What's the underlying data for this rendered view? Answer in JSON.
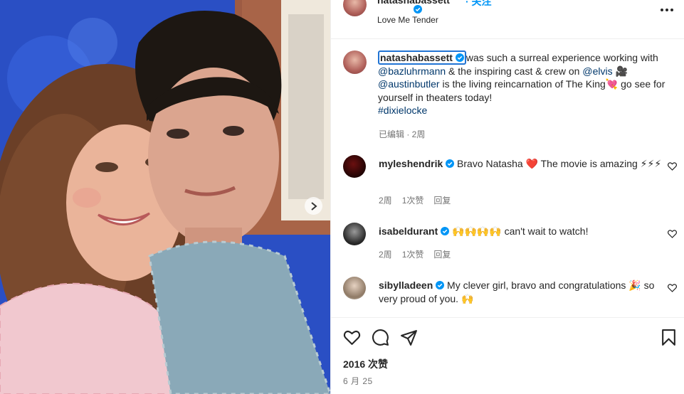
{
  "post": {
    "author": "natashabassett",
    "follow_label": "· 关注",
    "location": "Love Me Tender",
    "more_icon": "more-horizontal-icon"
  },
  "caption": {
    "username": "natashabassett",
    "text_1": "was such a surreal experience working with ",
    "mention_1": "@bazluhrmann",
    "text_2": " & the inspiring cast & crew on ",
    "mention_2": "@elvis",
    "text_3": " 🎥 ",
    "mention_3": "@austinbutler",
    "text_4": " is the living reincarnation of The King💘 go see for yourself in theaters today!",
    "hashtag": "#dixielocke",
    "meta": "已编辑 · 2周"
  },
  "comments": [
    {
      "user": "myleshendrik",
      "text": "Bravo Natasha ❤️ The movie is amazing ⚡⚡⚡",
      "time": "2周",
      "likes": "1次赞",
      "reply": "回复"
    },
    {
      "user": "isabeldurant",
      "text": "🙌🙌🙌🙌 can't wait to watch!",
      "time": "2周",
      "likes": "1次赞",
      "reply": "回复"
    },
    {
      "user": "sibylladeen",
      "text": "My clever girl, bravo and congratulations 🎉 so very proud of you. 🙌",
      "time": "",
      "likes": "",
      "reply": ""
    }
  ],
  "stats": {
    "likes": "2016 次赞",
    "date": "6 月 25"
  },
  "colors": {
    "link": "#00376b",
    "verified": "#0095f6",
    "focus_ring": "#2174d4",
    "muted": "#737373"
  }
}
